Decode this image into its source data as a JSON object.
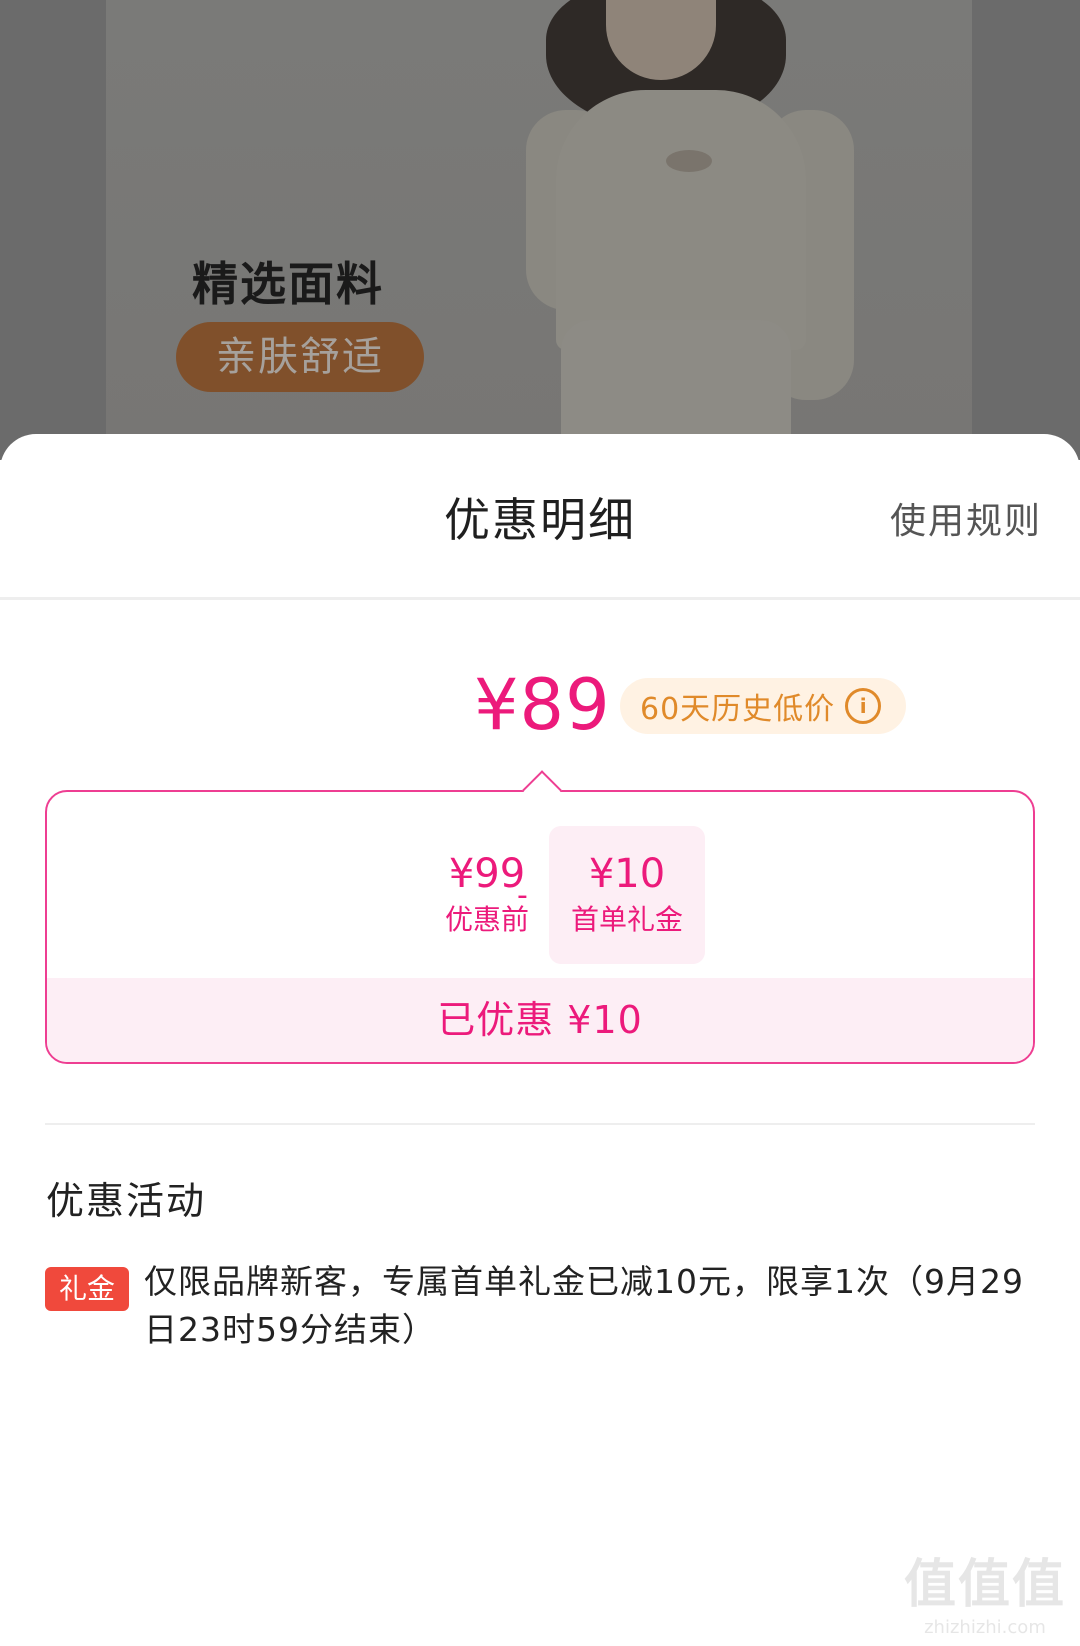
{
  "product_image": {
    "heading": "精选面料",
    "pill": "亲肤舒适"
  },
  "sheet": {
    "title": "优惠明细",
    "rules_link": "使用规则"
  },
  "price": {
    "final": "¥89",
    "history_badge": "60天历史低价",
    "info_icon": "i"
  },
  "breakdown": {
    "before_value": "¥99",
    "before_label": "优惠前",
    "operator": "-",
    "gift_value": "¥10",
    "gift_label": "首单礼金",
    "saved": "已优惠 ¥10"
  },
  "activities": {
    "title": "优惠活动",
    "items": [
      {
        "tag": "礼金",
        "text": "仅限品牌新客，专属首单礼金已减10元，限享1次（9月29日23时59分结束）"
      }
    ]
  },
  "watermark": {
    "mark": "值值值",
    "url": "zhizhizhi.com"
  },
  "colors": {
    "accent_pink": "#ec1a7b",
    "badge_orange": "#e08a2a",
    "tag_red": "#f0493c"
  }
}
